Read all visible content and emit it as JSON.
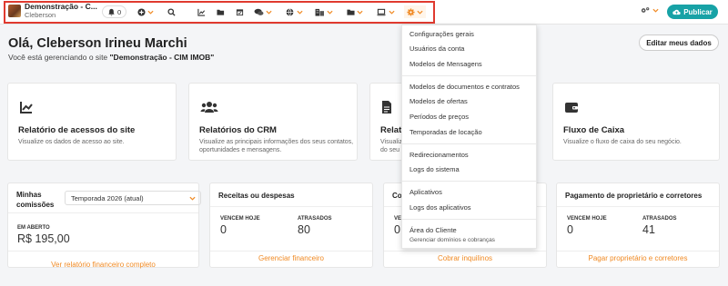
{
  "colors": {
    "accent": "#f08a24",
    "publish": "#17a2a6",
    "highlight": "#e03a2f"
  },
  "topbar": {
    "site_title": "Demonstração - C...",
    "user_name": "Cleberson",
    "notifications_count": "0",
    "publish_label": "Publicar",
    "icons": [
      "bell-icon",
      "plus-icon",
      "search-icon",
      "chart-icon",
      "folder-icon",
      "calendar-icon",
      "chat-icon",
      "globe-icon",
      "building-icon",
      "folder-icon",
      "laptop-icon",
      "gear-icon",
      "gears-icon",
      "cloud-upload-icon"
    ]
  },
  "greeting": {
    "title": "Olá, Cleberson Irineu Marchi",
    "subtitle_prefix": "Você está gerenciando o site ",
    "subtitle_site": "\"Demonstração - CIM IMOB\"",
    "edit_button": "Editar meus dados"
  },
  "cards": [
    {
      "title": "Relatório de acessos do site",
      "desc": "Visualize os dados de acesso ao site."
    },
    {
      "title": "Relatórios do CRM",
      "desc": "Visualize as principais informações dos seus contatos, oportunidades e mensagens."
    },
    {
      "title": "Relat",
      "desc": "Visualiz do seu"
    },
    {
      "title": "Fluxo de Caixa",
      "desc": "Visualize o fluxo de caixa do seu negócio."
    }
  ],
  "panels": {
    "commissions": {
      "title": "Minhas comissões",
      "select_value": "Temporada 2026 (atual)",
      "label": "EM ABERTO",
      "value": "R$ 195,00",
      "link": "Ver relatório financeiro completo"
    },
    "revenue": {
      "title": "Receitas ou despesas",
      "label1": "VENCEM HOJE",
      "value1": "0",
      "label2": "ATRASADOS",
      "value2": "80",
      "link": "Gerenciar financeiro"
    },
    "tenants": {
      "title": "Cob",
      "label1": "VEN",
      "value1": "0",
      "link": "Cobrar inquilinos"
    },
    "owners": {
      "title": "Pagamento de proprietário e corretores",
      "label1": "VENCEM HOJE",
      "value1": "0",
      "label2": "ATRASADOS",
      "value2": "41",
      "link": "Pagar proprietário e corretores"
    }
  },
  "settings_menu": {
    "items": [
      "Configurações gerais",
      "Usuários da conta",
      "Modelos de Mensagens",
      "Modelos de documentos e contratos",
      "Modelos de ofertas",
      "Períodos de preços",
      "Temporadas de locação",
      "Redirecionamentos",
      "Logs do sistema",
      "Aplicativos",
      "Logs dos aplicativos",
      "Área do Cliente"
    ],
    "client_area_sub": "Gerenciar domínios e cobranças"
  }
}
